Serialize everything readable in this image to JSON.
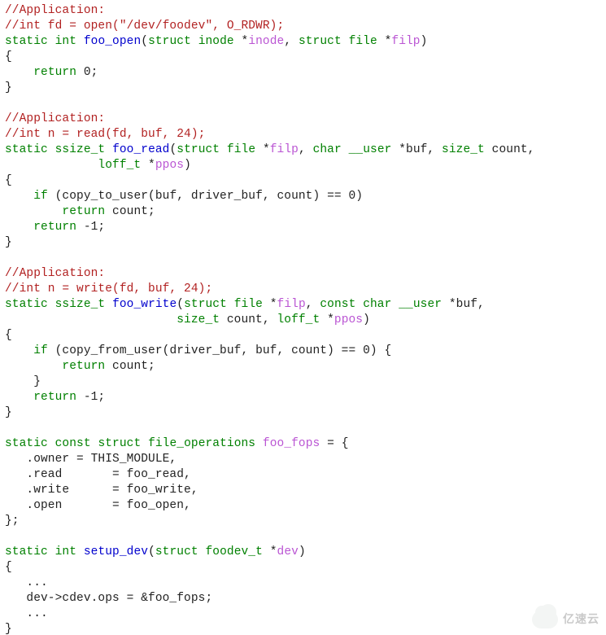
{
  "s1": {
    "c1": "//Application:",
    "c2": "//int fd = open(\"/dev/foodev\", O_RDWR);",
    "static": "static",
    "int": "int",
    "fn": "foo_open",
    "p_open": "(",
    "struct1": "struct",
    "inode_t": "inode",
    "star1": " *",
    "inode_v": "inode",
    "comma1": ", ",
    "struct2": "struct",
    "file_t": "file",
    "star2": " *",
    "filp_v": "filp",
    "p_close": ")",
    "brace_open": "{",
    "ret": "return",
    "zero": " 0;",
    "brace_close": "}"
  },
  "s2": {
    "c1": "//Application:",
    "c2": "//int n = read(fd, buf, 24);",
    "static": "static",
    "ssize": "ssize_t",
    "fn": "foo_read",
    "p_open": "(",
    "struct1": "struct",
    "file_t": "file",
    "star1": " *",
    "filp_v": "filp",
    "comma1": ", ",
    "char": "char",
    "user": "__user",
    "star2": " *buf, ",
    "size_t": "size_t",
    "count": " count,",
    "loff": "loff_t",
    "star3": " *",
    "ppos": "ppos",
    "p_close": ")",
    "brace_open": "{",
    "if": "if",
    "cond": " (copy_to_user(buf, driver_buf, count) == 0)",
    "ret1": "return",
    "ret1_tail": " count;",
    "ret2": "return",
    "ret2_tail": " -1;",
    "brace_close": "}"
  },
  "s3": {
    "c1": "//Application:",
    "c2": "//int n = write(fd, buf, 24);",
    "static": "static",
    "ssize": "ssize_t",
    "fn": "foo_write",
    "p_open": "(",
    "struct1": "struct",
    "file_t": "file",
    "star1": " *",
    "filp_v": "filp",
    "comma1": ", ",
    "const": "const",
    "char": "char",
    "user": "__user",
    "star2": " *buf,",
    "size_t": "size_t",
    "count": " count, ",
    "loff": "loff_t",
    "star3": " *",
    "ppos": "ppos",
    "p_close": ")",
    "brace_open": "{",
    "if": "if",
    "cond": " (copy_from_user(driver_buf, buf, count) == 0) {",
    "ret1": "return",
    "ret1_tail": " count;",
    "inner_close": "    }",
    "ret2": "return",
    "ret2_tail": " -1;",
    "brace_close": "}"
  },
  "s4": {
    "static": "static",
    "const": "const",
    "struct": "struct",
    "fops_t": "file_operations",
    "fops_v": "foo_fops",
    "eq": " = {",
    "owner": "   .owner = THIS_MODULE,",
    "read": "   .read       = foo_read,",
    "write": "   .write      = foo_write,",
    "open": "   .open       = foo_open,",
    "close": "};"
  },
  "s5": {
    "static": "static",
    "int": "int",
    "fn": "setup_dev",
    "p_open": "(",
    "struct": "struct",
    "foodev": "foodev_t",
    "star": " *",
    "dev": "dev",
    "p_close": ")",
    "brace_open": "{",
    "dots1": "   ...",
    "assign": "   dev->cdev.ops = &foo_fops;",
    "dots2": "   ...",
    "brace_close": "}"
  },
  "watermark": "亿速云"
}
